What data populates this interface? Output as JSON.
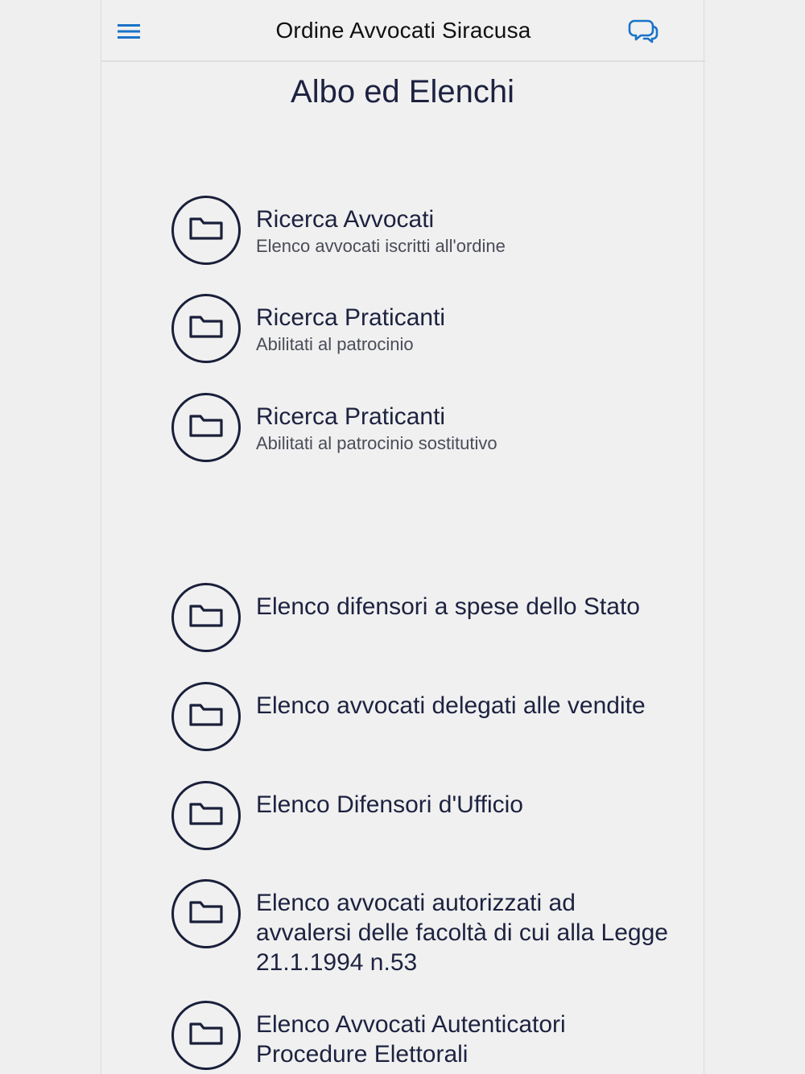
{
  "app_bar": {
    "title": "Ordine Avvocati Siracusa",
    "menu_icon": "hamburger-menu-icon",
    "chat_icon": "chat-bubbles-icon",
    "accent_color": "#1a73c8"
  },
  "page": {
    "title": "Albo ed Elenchi"
  },
  "items": [
    {
      "title": "Ricerca Avvocati",
      "subtitle": "Elenco avvocati iscritti all'ordine",
      "icon": "folder-icon"
    },
    {
      "title": "Ricerca Praticanti",
      "subtitle": "Abilitati al patrocinio",
      "icon": "folder-icon"
    },
    {
      "title": "Ricerca Praticanti",
      "subtitle": "Abilitati al patrocinio sostitutivo",
      "icon": "folder-icon"
    },
    {
      "title": "Elenco difensori a spese dello Stato",
      "icon": "folder-icon"
    },
    {
      "title": "Elenco avvocati delegati alle vendite",
      "icon": "folder-icon"
    },
    {
      "title": "Elenco Difensori d'Ufficio",
      "icon": "folder-icon"
    },
    {
      "title": "Elenco avvocati autorizzati ad avvalersi delle facoltà di cui alla Legge 21.1.1994 n.53",
      "icon": "folder-icon"
    },
    {
      "title": "Elenco Avvocati Autenticatori Procedure Elettorali",
      "icon": "folder-icon"
    }
  ],
  "colors": {
    "icon_stroke": "#1a1f3a",
    "background": "#f0f0f0"
  }
}
